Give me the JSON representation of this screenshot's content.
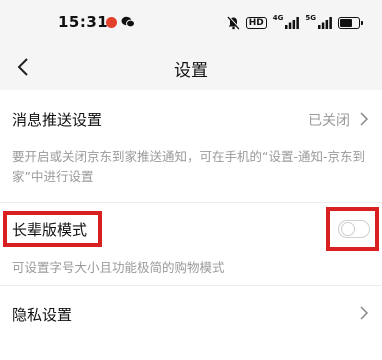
{
  "status_bar": {
    "time": "15:31",
    "icons": [
      "app-notification-icon",
      "wechat-icon",
      "mute-icon",
      "hd-icon",
      "signal-4g-icon",
      "signal-5g-icon",
      "battery-icon"
    ],
    "hd_label": "HD",
    "net1_label": "4G",
    "net2_label": "5G"
  },
  "nav": {
    "title": "设置",
    "back_icon": "chevron-left-icon"
  },
  "settings": {
    "push": {
      "title": "消息推送设置",
      "value": "已关闭",
      "description": "要开启或关闭京东到家推送通知，可在手机的“设置-通知-京东到家”中进行设置"
    },
    "elder_mode": {
      "title": "长辈版模式",
      "description": "可设置字号大小且功能极简的购物模式",
      "enabled": false
    },
    "privacy": {
      "title": "隐私设置"
    }
  },
  "colors": {
    "highlight": "#d92020",
    "background": "#f5f5f5",
    "secondary_text": "#9a9a9a"
  }
}
